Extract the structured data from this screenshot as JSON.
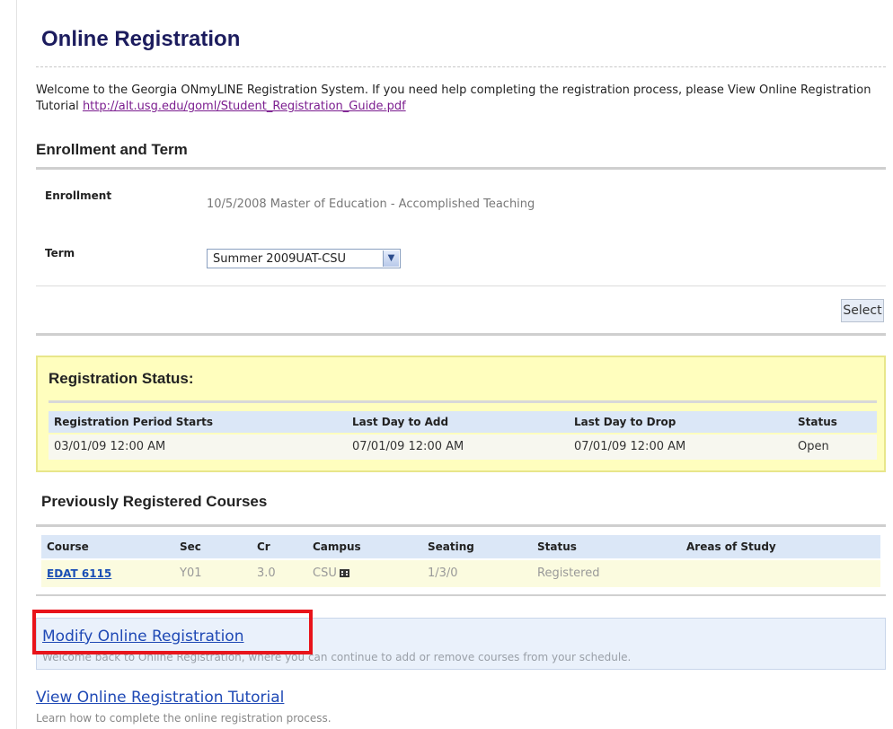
{
  "page": {
    "title": "Online Registration",
    "welcome_text": "Welcome to the Georgia ONmyLINE Registration System. If you need help completing the registration process, please View Online Registration Tutorial ",
    "tutorial_url": "http://alt.usg.edu/goml/Student_Registration_Guide.pdf"
  },
  "enrollment": {
    "heading": "Enrollment and Term",
    "enrollment_label": "Enrollment",
    "enrollment_value": "10/5/2008 Master of Education - Accomplished Teaching",
    "term_label": "Term",
    "term_selected": "Summer 2009UAT-CSU",
    "select_button": "Select"
  },
  "registration_status": {
    "heading": "Registration Status:",
    "columns": [
      "Registration Period Starts",
      "Last Day to Add",
      "Last Day to Drop",
      "Status"
    ],
    "row": [
      "03/01/09 12:00 AM",
      "07/01/09 12:00 AM",
      "07/01/09 12:00 AM",
      "Open"
    ]
  },
  "previous_courses": {
    "heading": "Previously Registered Courses",
    "columns": [
      "Course",
      "Sec",
      "Cr",
      "Campus",
      "Seating",
      "Status",
      "Areas of Study"
    ],
    "rows": [
      {
        "course": "EDAT 6115",
        "sec": "Y01",
        "cr": "3.0",
        "campus": "CSU",
        "seating": "1/3/0",
        "status": "Registered",
        "areas": ""
      }
    ]
  },
  "modify": {
    "link": "Modify Online Registration",
    "description": "Welcome back to Online Registration, where you can continue to add or remove courses from your schedule."
  },
  "tutorial": {
    "link": "View Online Registration Tutorial",
    "description": "Learn how to complete the online registration process."
  },
  "colors": {
    "title": "#1c1c5e",
    "status_box_bg": "#fffebe",
    "highlight": "#e8141b",
    "link": "#1f49b5"
  }
}
